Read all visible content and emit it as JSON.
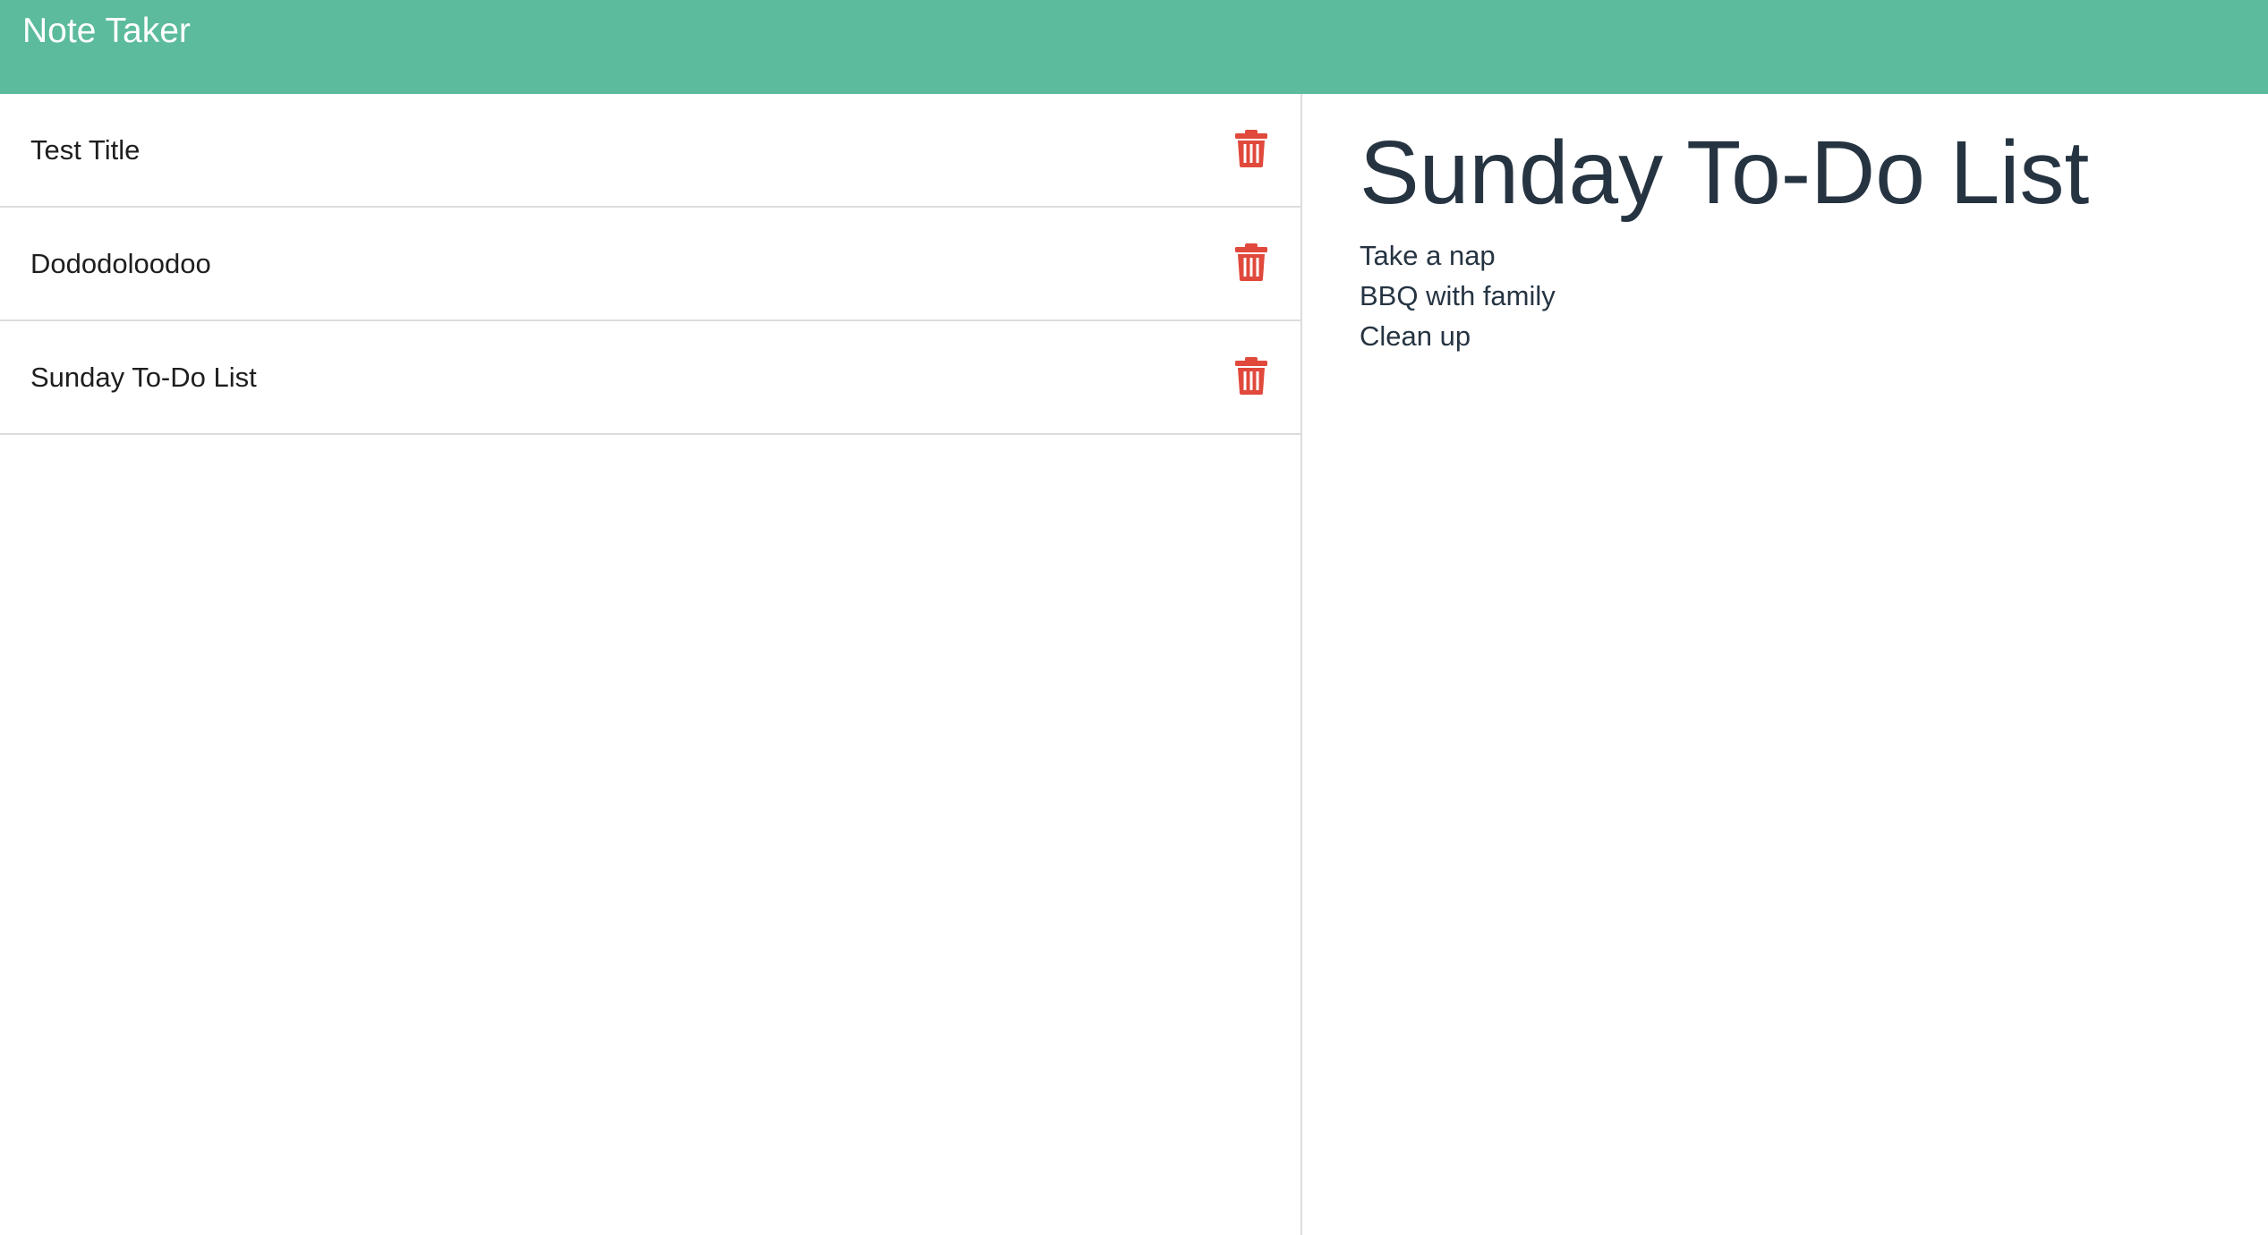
{
  "app": {
    "brand": "Note Taker"
  },
  "colors": {
    "navbar": "#5bbb9c",
    "delete_icon": "#e0493c",
    "text_dark": "#263442"
  },
  "notes": [
    {
      "title": "Test Title",
      "icon": "trash-icon"
    },
    {
      "title": "Dododoloodoo",
      "icon": "trash-icon"
    },
    {
      "title": "Sunday To-Do List",
      "icon": "trash-icon"
    }
  ],
  "active_note": {
    "title": "Sunday To-Do List",
    "lines": [
      "Take a nap",
      "BBQ with family",
      "Clean up"
    ]
  }
}
